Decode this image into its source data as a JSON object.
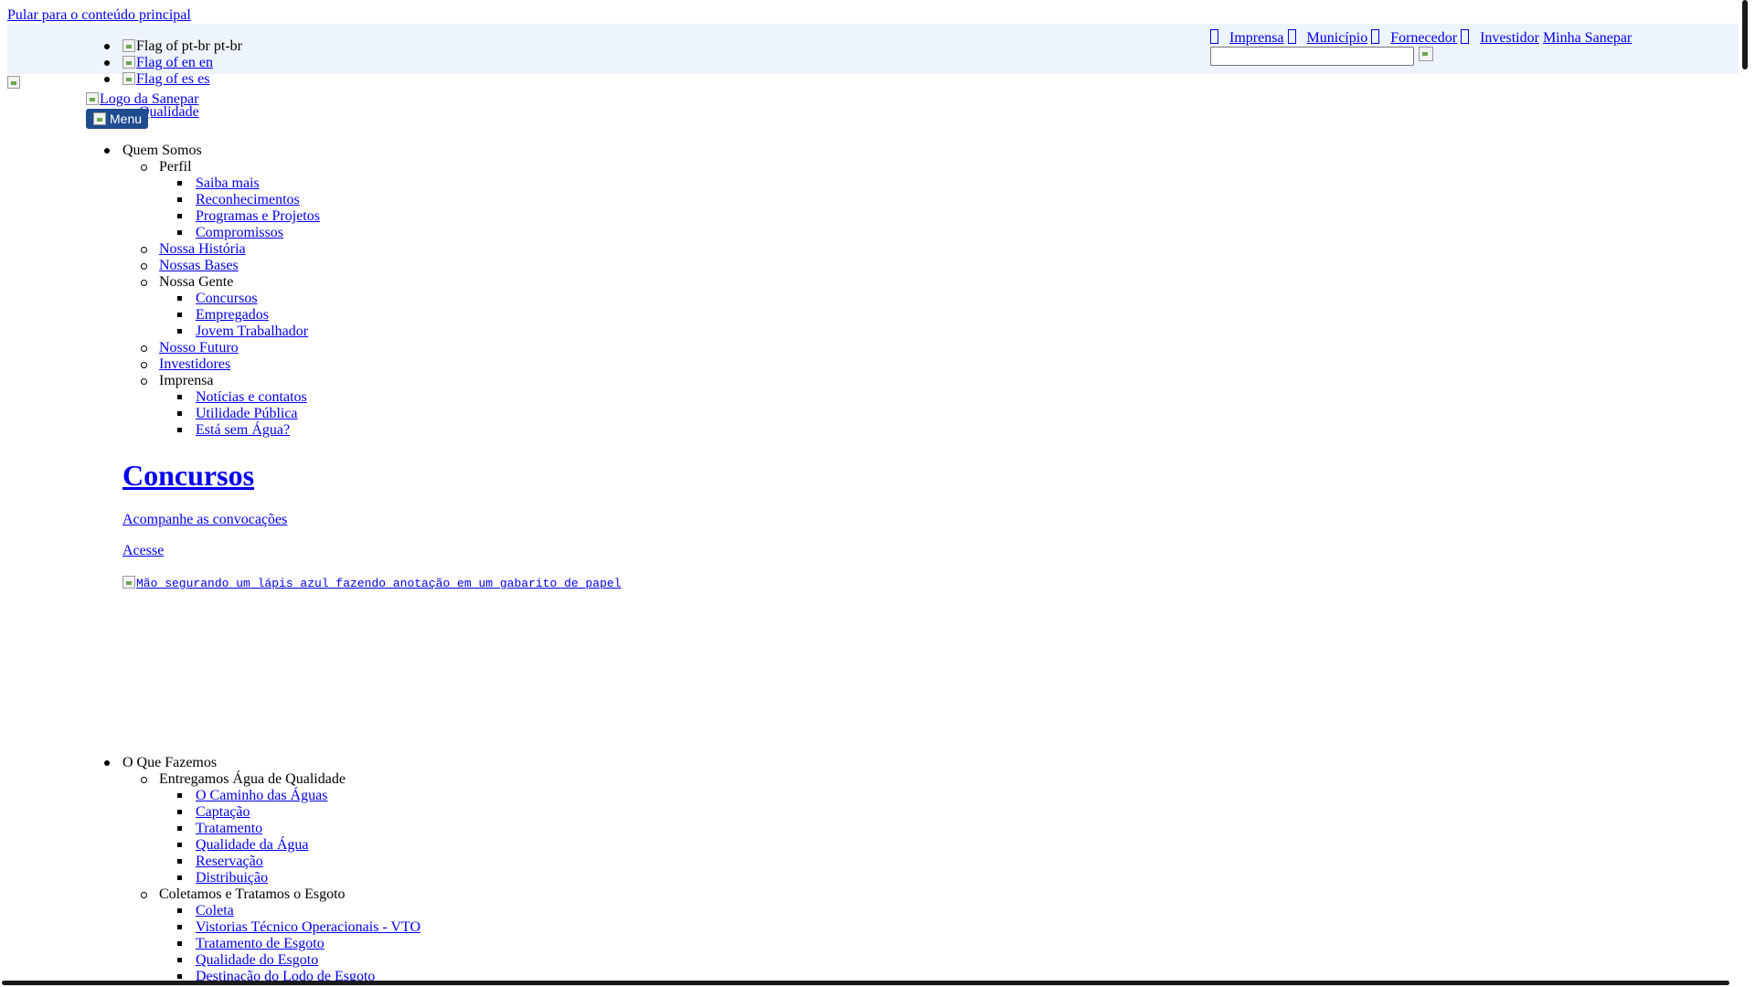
{
  "skip_link": "Pular para o conteúdo principal",
  "languages": [
    {
      "flag_alt": "Flag of pt-br",
      "code": "pt-br"
    },
    {
      "flag_alt": "Flag of en",
      "code": "en"
    },
    {
      "flag_alt": "Flag of es",
      "code": "es"
    }
  ],
  "top_nav": {
    "imprensa": "Imprensa",
    "municipio": "Município",
    "fornecedor": "Fornecedor",
    "investidor": "Investidor",
    "minha_sanepar": "Minha Sanepar"
  },
  "search": {
    "placeholder": "",
    "value": ""
  },
  "logo_alt": "Logo da Sanepar",
  "overlap_text": "Qualidade",
  "menu_button": "Menu",
  "menu": {
    "quem_somos": "Quem Somos",
    "perfil": "Perfil",
    "perfil_items": [
      "Saiba mais",
      "Reconhecimentos",
      "Programas e Projetos",
      "Compromissos"
    ],
    "nossa_historia": "Nossa História",
    "nossas_bases": "Nossas Bases",
    "nossa_gente": "Nossa Gente",
    "nossa_gente_items": [
      "Concursos",
      "Empregados",
      "Jovem Trabalhador"
    ],
    "nosso_futuro": "Nosso Futuro",
    "investidores": "Investidores",
    "imprensa": "Imprensa",
    "imprensa_items": [
      "Notícias e contatos",
      "Utilidade Pública",
      "Está sem Água?"
    ],
    "o_que_fazemos": "O Que Fazemos",
    "agua": "Entregamos Água de Qualidade",
    "agua_items": [
      "O Caminho das Águas",
      "Captação",
      "Tratamento",
      "Qualidade da Água",
      "Reservação",
      "Distribuição"
    ],
    "esgoto": "Coletamos e Tratamos o Esgoto",
    "esgoto_items": [
      "Coleta",
      "Vistorias Técnico Operacionais - VTO",
      "Tratamento de Esgoto",
      "Qualidade do Esgoto",
      "Destinação do Lodo de Esgoto"
    ]
  },
  "banner": {
    "title": "Concursos",
    "subtitle": "Acompanhe as convocações",
    "cta": "Acesse",
    "image_alt": "Mão segurando um lápis azul fazendo anotação em um gabarito de papel"
  }
}
